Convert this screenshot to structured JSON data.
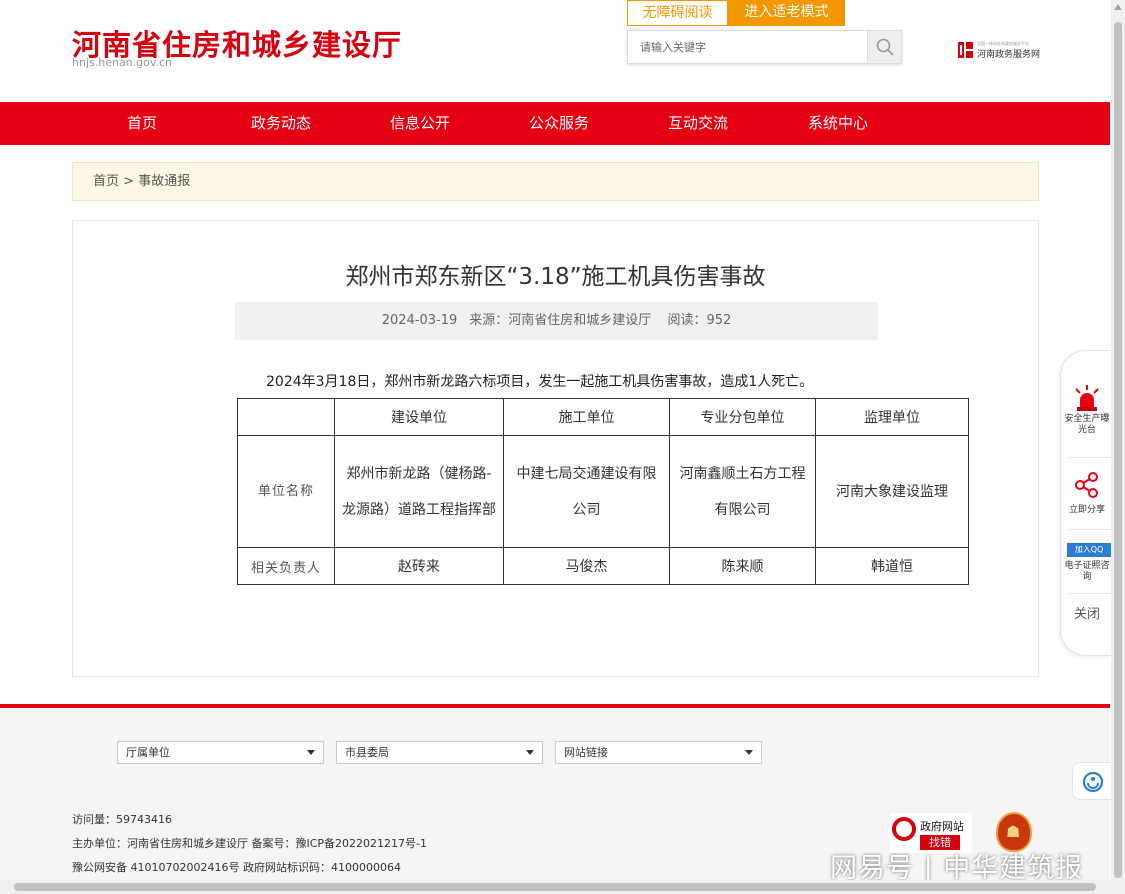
{
  "header": {
    "site_title": "河南省住房和城乡建设厅",
    "site_url": "hnjs.henan.gov.cn",
    "accessible_label": "无障碍阅读",
    "elder_mode_label": "进入适老模式",
    "search_placeholder": "请输入关键字",
    "gov_service_small": "全国一体化在线政务服务平台",
    "gov_service_name": "河南政务服务网"
  },
  "nav": {
    "items": [
      "首页",
      "政务动态",
      "信息公开",
      "公众服务",
      "互动交流",
      "系统中心"
    ]
  },
  "breadcrumb": {
    "home": "首页",
    "separator": ">",
    "current": "事故通报"
  },
  "article": {
    "title": "郑州市郑东新区“3.18”施工机具伤害事故",
    "date": "2024-03-19",
    "source": "来源：河南省住房和城乡建设厅",
    "reads": "阅读：952",
    "lead": "2024年3月18日，郑州市新龙路六标项目，发生一起施工机具伤害事故，造成1人死亡。",
    "table": {
      "headers": [
        "",
        "建设单位",
        "施工单位",
        "专业分包单位",
        "监理单位"
      ],
      "row_unit_label": "单位名称",
      "units": [
        "郑州市新龙路（健杨路-龙源路）道路工程指挥部",
        "中建七局交通建设有限公司",
        "河南鑫顺土石方工程有限公司",
        "河南大象建设监理"
      ],
      "row_person_label": "相关负责人",
      "persons": [
        "赵砖来",
        "马俊杰",
        "陈来顺",
        "韩道恒"
      ]
    }
  },
  "footer": {
    "selects": [
      "厅属单位",
      "市县委局",
      "网站链接"
    ],
    "visits": "访问量：59743416",
    "sponsor": "主办单位：河南省住房和城乡建设厅 备案号：豫ICP备2022021217号-1",
    "police": "豫公网安备 41010702002416号 政府网站标识码：4100000064",
    "find_error_1": "政府网站",
    "find_error_2": "找错",
    "emblem_text": "党政机关",
    "watermark": "网易号 | 中华建筑报"
  },
  "side_float": {
    "safety_label": "安全生产曝光台",
    "share_label": "立即分享",
    "qq_badge": "加入QQ",
    "cert_label": "电子证照咨询",
    "close_label": "关闭"
  },
  "colors": {
    "brand_red": "#e50012",
    "accent_orange": "#f39800",
    "breadcrumb_bg": "#fdf8e5"
  }
}
